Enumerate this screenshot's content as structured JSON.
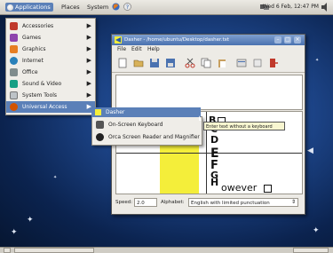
{
  "top_panel": {
    "applications": "Applications",
    "places": "Places",
    "system": "System",
    "clock": "Wed 6 Feb, 12:47 PM"
  },
  "apps_menu": {
    "items": [
      {
        "label": "Accessories",
        "icon": "accessories-icon"
      },
      {
        "label": "Games",
        "icon": "games-icon"
      },
      {
        "label": "Graphics",
        "icon": "graphics-icon"
      },
      {
        "label": "Internet",
        "icon": "internet-icon"
      },
      {
        "label": "Office",
        "icon": "office-icon"
      },
      {
        "label": "Sound & Video",
        "icon": "sound-video-icon"
      },
      {
        "label": "System Tools",
        "icon": "system-tools-icon"
      },
      {
        "label": "Universal Access",
        "icon": "universal-access-icon"
      }
    ]
  },
  "ua_menu": {
    "items": [
      {
        "label": "On-Screen Keyboard",
        "icon": "keyboard-icon"
      },
      {
        "label": "Orca Screen Reader and Magnifier",
        "icon": "orca-icon"
      }
    ]
  },
  "tooltip": "Enter text without a keyboard",
  "dasher": {
    "title": "Dasher - /home/ubuntu/Desktop/dasher.txt",
    "tab_label": "Dasher",
    "menu": [
      "File",
      "Edit",
      "Help"
    ],
    "chars": [
      "B",
      "C",
      "D",
      "E",
      "F",
      "G",
      "H",
      "owever"
    ],
    "speed_label": "Speed:",
    "speed_value": "2.0",
    "alphabet_label": "Alphabet:",
    "alphabet_value": "English with limited punctuation"
  },
  "colors": {
    "accent": "#5b80b8",
    "canvas_yellow": "#f4ee3a",
    "desktop": "#1d4589"
  }
}
